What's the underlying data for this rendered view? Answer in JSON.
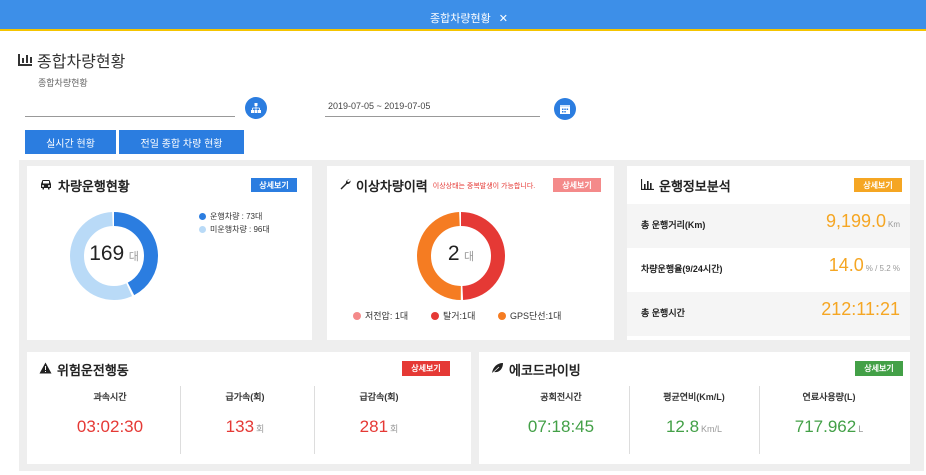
{
  "topbar": {
    "tab_label": "종합차량현황",
    "close_symbol": "✕"
  },
  "page": {
    "title": "종합차량현황",
    "breadcrumb": "종합차량현황"
  },
  "filters": {
    "date_range": "2019-07-05 ~ 2019-07-05"
  },
  "buttons": {
    "realtime": "실시간 현황",
    "all_vehicles": "전일 종합 차량 현황"
  },
  "vehicle_status": {
    "title": "차량운행현황",
    "detail_label": "상세보기",
    "total": "169",
    "unit": "대",
    "legend": [
      {
        "label": "운행차량 : 73대",
        "color": "#2b7de0"
      },
      {
        "label": "미운행차량 : 96대",
        "color": "#b9daf7"
      }
    ],
    "running": 73,
    "idle": 96
  },
  "abnormal": {
    "title": "이상차량이력",
    "warning": "이상상태는 중복발생이 가능합니다.",
    "detail_label": "상세보기",
    "total": "2",
    "unit": "대",
    "legend": [
      {
        "label": "저전압: 1대",
        "color": "#f48a8a"
      },
      {
        "label": "탈거:1대",
        "color": "#e53935"
      },
      {
        "label": "GPS단선:1대",
        "color": "#f57c22"
      }
    ],
    "values": [
      0,
      1,
      1
    ]
  },
  "analysis": {
    "title": "운행정보분석",
    "detail_label": "상세보기",
    "rows": [
      {
        "label": "총 운행거리(Km)",
        "value": "9,199.0",
        "unit": "Km"
      },
      {
        "label": "차량운행율(9/24시간)",
        "value": "14.0",
        "unit": "% / 5.2 %"
      },
      {
        "label": "총 운행시간",
        "value": "212:11:21",
        "unit": ""
      }
    ]
  },
  "danger": {
    "title": "위험운전행동",
    "detail_label": "상세보기",
    "metrics": [
      {
        "label": "과속시간",
        "value": "03:02:30",
        "unit": ""
      },
      {
        "label": "급가속(회)",
        "value": "133",
        "unit": "회"
      },
      {
        "label": "급감속(회)",
        "value": "281",
        "unit": "회"
      }
    ]
  },
  "eco": {
    "title": "에코드라이빙",
    "detail_label": "상세보기",
    "metrics": [
      {
        "label": "공회전시간",
        "value": "07:18:45",
        "unit": ""
      },
      {
        "label": "평균연비(Km/L)",
        "value": "12.8",
        "unit": "Km/L"
      },
      {
        "label": "연료사용량(L)",
        "value": "717.962",
        "unit": "L"
      }
    ]
  },
  "colors": {
    "header_blue": "#3d8fe8",
    "accent_yellow": "#f5c400",
    "orange": "#f5a623",
    "red": "#e53935",
    "green": "#43a047"
  }
}
